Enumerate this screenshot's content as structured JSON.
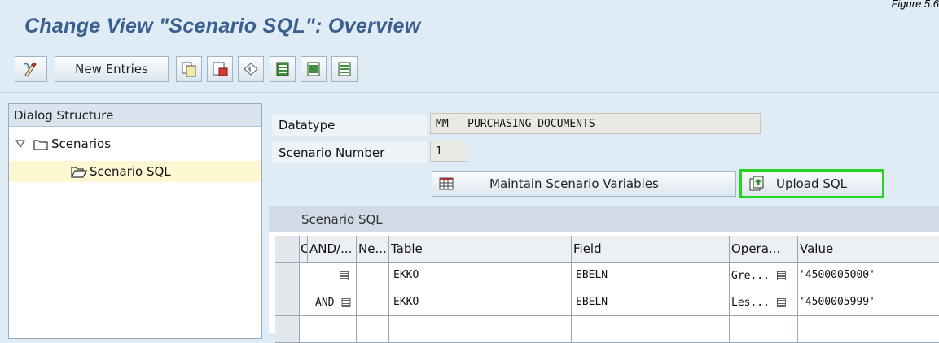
{
  "figure_tag": "Figure 5.6",
  "page_title": "Change View \"Scenario SQL\": Overview",
  "toolbar": {
    "new_entries_label": "New Entries",
    "icons": [
      "edit-toggle-icon",
      "copy-icon",
      "delete-icon",
      "undo-icon",
      "select-all-icon",
      "select-block-icon",
      "deselect-all-icon"
    ]
  },
  "dialog_structure": {
    "title": "Dialog Structure",
    "tree": [
      {
        "label": "Scenarios",
        "expanded": true
      },
      {
        "label": "Scenario SQL",
        "selected": true
      }
    ]
  },
  "header_fields": {
    "datatype_label": "Datatype",
    "datatype_value": "MM - PURCHASING DOCUMENTS",
    "scenario_number_label": "Scenario Number",
    "scenario_number_value": "1"
  },
  "actions": {
    "maintain_variables_label": "Maintain Scenario Variables",
    "upload_sql_label": "Upload SQL",
    "highlight_color": "#24d324"
  },
  "table": {
    "caption": "Scenario SQL",
    "columns": [
      "O",
      "AND/...",
      "Ne...",
      "Table",
      "Field",
      "Opera...",
      "Value"
    ],
    "rows": [
      {
        "andor": "",
        "table": "EKKO",
        "field": "EBELN",
        "operator": "Gre...",
        "value": "'4500005000'"
      },
      {
        "andor": "AND",
        "table": "EKKO",
        "field": "EBELN",
        "operator": "Les...",
        "value": "'4500005999'"
      }
    ]
  },
  "colors": {
    "title": "#3b5f8c",
    "background": "#dfebf5"
  }
}
